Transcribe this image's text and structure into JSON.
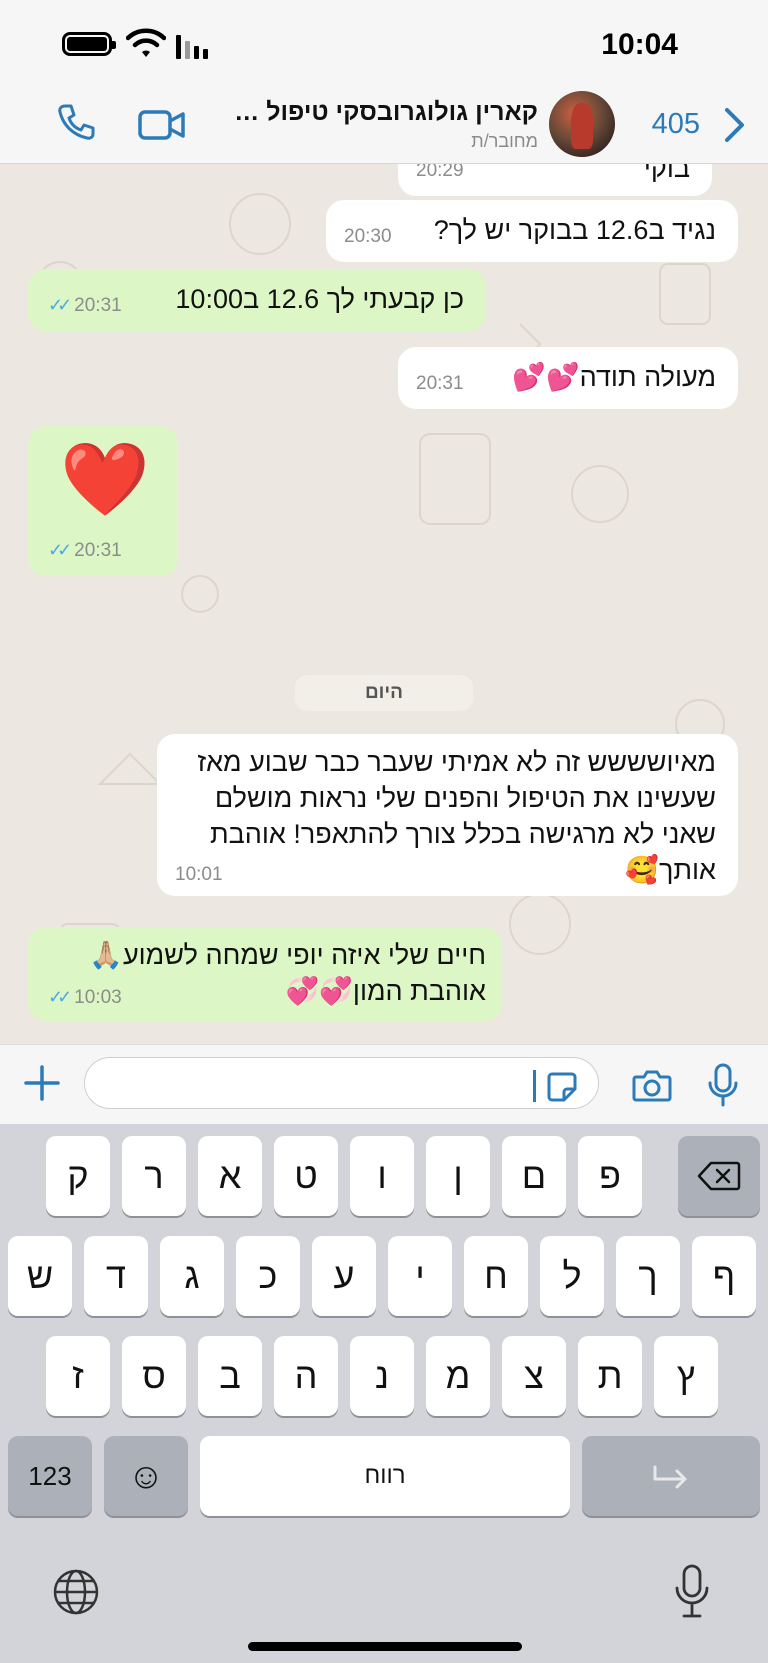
{
  "status_bar": {
    "time": "10:04"
  },
  "header": {
    "back_count": "405",
    "contact_name": "קארין גולוגרובסקי טיפול פ...",
    "contact_status": "מחובר/ת"
  },
  "chat": {
    "messages": [
      {
        "text": "בוקי",
        "time": "20:29"
      },
      {
        "text": "נגיד ב12.6 בבוקר יש לך?",
        "time": "20:30"
      },
      {
        "text": "כן קבעתי לך 12.6 ב10:00",
        "time": "20:31"
      },
      {
        "text": "מעולה תודה💕💕",
        "time": "20:31"
      },
      {
        "text": "❤️",
        "time": "20:31"
      },
      {
        "text": "מאיושששש זה לא אמיתי שעבר כבר שבוע מאז שעשינו את הטיפול והפנים שלי נראות מושלם שאני לא מרגישה בכלל צורך להתאפר! אוהבת אותך🥰",
        "time": "10:01"
      },
      {
        "text": "חיים שלי איזה יופי שמחה לשמוע🙏🏼 אוהבת המון💞💞",
        "time": "10:03"
      }
    ],
    "date_separator": "היום"
  },
  "input": {
    "placeholder": ""
  },
  "keyboard": {
    "row1": [
      "פ",
      "ם",
      "ן",
      "ו",
      "ט",
      "א",
      "ר",
      "ק"
    ],
    "row2": [
      "ף",
      "ך",
      "ל",
      "ח",
      "י",
      "ע",
      "כ",
      "ג",
      "ד",
      "ש"
    ],
    "row3": [
      "ץ",
      "ת",
      "צ",
      "מ",
      "נ",
      "ה",
      "ב",
      "ס",
      "ז"
    ],
    "num_label": "123",
    "space_label": "רווח",
    "emoji": "☺"
  },
  "colors": {
    "accent": "#2c7bb8",
    "outgoing": "#dcf7c5",
    "incoming": "#ffffff",
    "read_ticks": "#4fa8e6"
  },
  "icons": [
    "battery-icon",
    "wifi-icon",
    "signal-icon",
    "back-chevron-icon",
    "video-call-icon",
    "phone-call-icon",
    "plus-icon",
    "sticker-icon",
    "camera-icon",
    "microphone-icon",
    "backspace-icon",
    "return-icon",
    "globe-icon",
    "dictation-icon"
  ]
}
